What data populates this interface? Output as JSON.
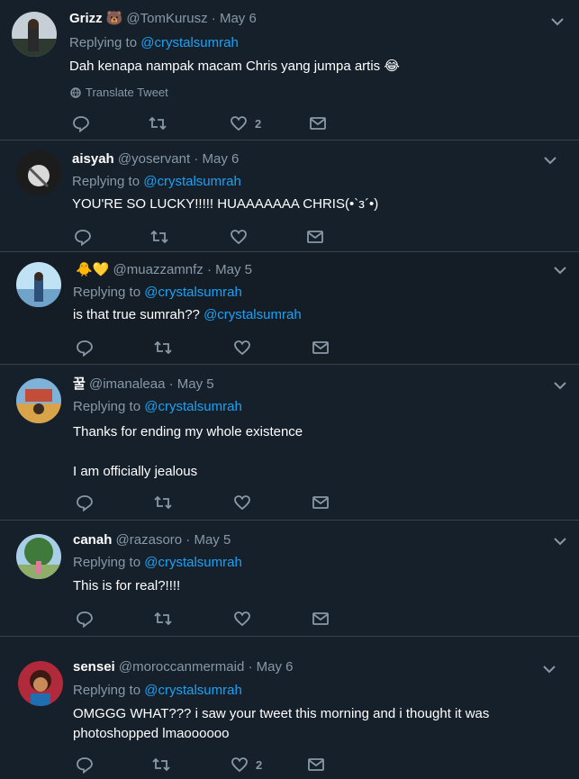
{
  "replying_label": "Replying to",
  "translate_label": "Translate Tweet",
  "tweets": [
    {
      "name": "Grizz",
      "name_emoji": "🐻",
      "handle": "@TomKurusz",
      "date": "· May 6",
      "reply_to": "@crystalsumrah",
      "text": [
        "Dah kenapa nampak macam Chris yang jumpa artis 😂"
      ],
      "mention": "",
      "likes": "2",
      "show_translate": true
    },
    {
      "name": "aisyah",
      "name_emoji": "",
      "handle": "@yoservant",
      "date": "· May 6",
      "reply_to": "@crystalsumrah",
      "text": [
        "YOU'RE SO LUCKY!!!!! HUAAAAAAA CHRIS(•`з´•)"
      ],
      "mention": "",
      "likes": "",
      "show_translate": false
    },
    {
      "name": "🐥💛",
      "name_emoji": "",
      "handle": "@muazzamnfz",
      "date": "· May 5",
      "reply_to": "@crystalsumrah",
      "text": [
        "is that true sumrah??"
      ],
      "mention": "@crystalsumrah",
      "likes": "",
      "show_translate": false
    },
    {
      "name": "꿀",
      "name_emoji": "",
      "handle": "@imanaleaa",
      "date": "· May 5",
      "reply_to": "@crystalsumrah",
      "text": [
        "Thanks for ending my whole existence",
        "",
        "I am officially jealous"
      ],
      "mention": "",
      "likes": "",
      "show_translate": false
    },
    {
      "name": "canah",
      "name_emoji": "",
      "handle": "@razasoro",
      "date": "· May 5",
      "reply_to": "@crystalsumrah",
      "text": [
        "This is for real?!!!!"
      ],
      "mention": "",
      "likes": "",
      "show_translate": false
    },
    {
      "name": "sensei",
      "name_emoji": "",
      "handle": "@moroccanmermaid",
      "date": "· May 6",
      "reply_to": "@crystalsumrah",
      "text": [
        "OMGGG WHAT??? i saw your tweet this morning and i thought it was",
        "photoshopped lmaoooooo"
      ],
      "mention": "",
      "likes": "2",
      "show_translate": false
    }
  ],
  "icons": [
    "reply-icon",
    "retweet-icon",
    "like-icon",
    "dm-icon",
    "chevron-down-icon",
    "globe-icon"
  ],
  "colors": {
    "background": "#15202b",
    "link": "#1da1f2",
    "muted": "#8899a6",
    "divider": "#38444d"
  }
}
